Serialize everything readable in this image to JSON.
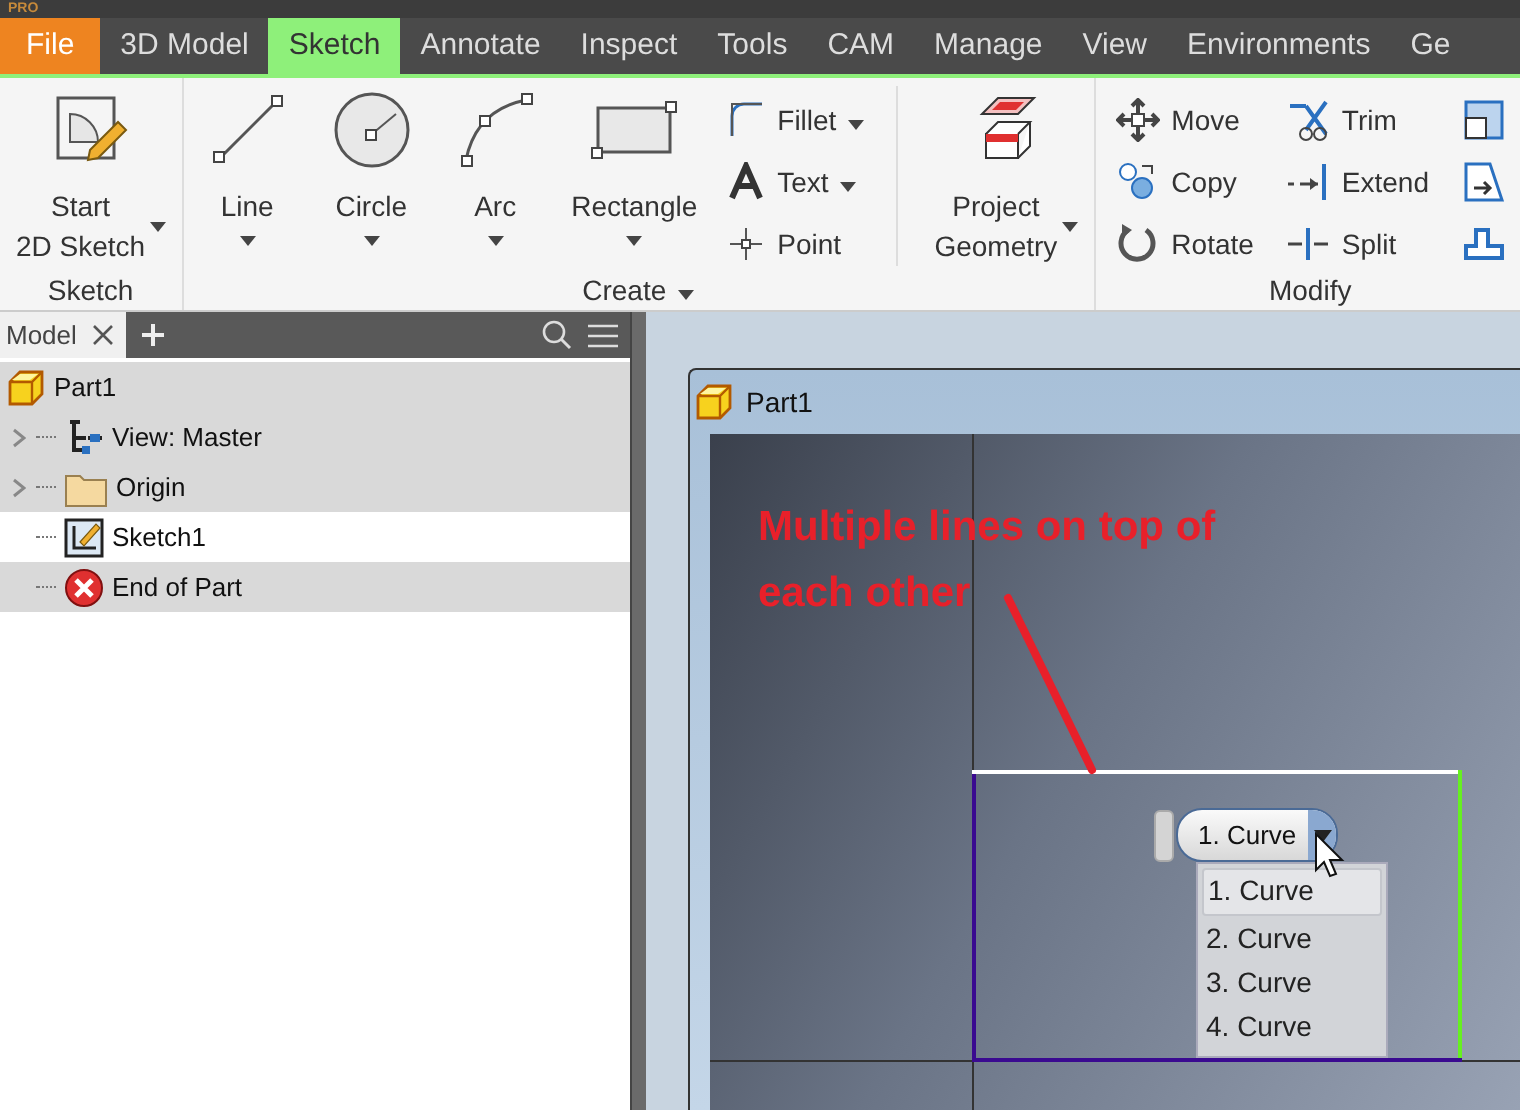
{
  "title_bar": {
    "edition": "PRO"
  },
  "ribbon_tabs": [
    {
      "label": "File",
      "kind": "application",
      "selected": false
    },
    {
      "label": "3D Model",
      "kind": "tab",
      "selected": false
    },
    {
      "label": "Sketch",
      "kind": "tab",
      "selected": true
    },
    {
      "label": "Annotate",
      "kind": "tab",
      "selected": false
    },
    {
      "label": "Inspect",
      "kind": "tab",
      "selected": false
    },
    {
      "label": "Tools",
      "kind": "tab",
      "selected": false
    },
    {
      "label": "CAM",
      "kind": "tab",
      "selected": false
    },
    {
      "label": "Manage",
      "kind": "tab",
      "selected": false
    },
    {
      "label": "View",
      "kind": "tab",
      "selected": false
    },
    {
      "label": "Environments",
      "kind": "tab",
      "selected": false
    },
    {
      "label": "Ge",
      "kind": "tab",
      "selected": false
    }
  ],
  "ribbon_panels": [
    {
      "title": "Sketch",
      "has_menu": false,
      "groups": [
        {
          "kind": "large",
          "tools": [
            {
              "label": "Start\n2D Sketch",
              "has_menu": true
            }
          ]
        }
      ]
    },
    {
      "title": "Create",
      "has_menu": true,
      "groups": [
        {
          "kind": "large",
          "tools": [
            {
              "label": "Line",
              "has_menu": true
            },
            {
              "label": "Circle",
              "has_menu": true
            },
            {
              "label": "Arc",
              "has_menu": true
            },
            {
              "label": "Rectangle",
              "has_menu": true
            }
          ]
        },
        {
          "kind": "small",
          "tools": [
            {
              "label": "Fillet",
              "has_menu": true
            },
            {
              "label": "Text",
              "has_menu": true
            },
            {
              "label": "Point",
              "has_menu": false
            }
          ]
        },
        {
          "kind": "large",
          "tools": [
            {
              "label": "Project\nGeometry",
              "has_menu": true
            }
          ]
        }
      ]
    },
    {
      "title": "Modify",
      "has_menu": false,
      "groups": [
        {
          "kind": "small",
          "tools": [
            {
              "label": "Move",
              "has_menu": false
            },
            {
              "label": "Copy",
              "has_menu": false
            },
            {
              "label": "Rotate",
              "has_menu": false
            }
          ]
        },
        {
          "kind": "small",
          "tools": [
            {
              "label": "Trim",
              "has_menu": false
            },
            {
              "label": "Extend",
              "has_menu": false
            },
            {
              "label": "Split",
              "has_menu": false
            }
          ]
        },
        {
          "kind": "small",
          "tools": [
            {
              "has_menu": false
            },
            {
              "has_menu": false
            },
            {
              "has_menu": false
            }
          ]
        }
      ]
    }
  ],
  "model_browser": {
    "tab": "Model",
    "items": [
      {
        "label": "Part1",
        "kind": "part",
        "active": false,
        "children": [
          {
            "label": "View: Master",
            "kind": "view",
            "active": false,
            "expandable": true
          },
          {
            "label": "Origin",
            "kind": "folder",
            "active": false,
            "expandable": true
          },
          {
            "label": "Sketch1",
            "kind": "sketch",
            "active": true,
            "expandable": false
          },
          {
            "label": "End of Part",
            "kind": "end",
            "active": false,
            "expandable": false
          }
        ]
      }
    ]
  },
  "document_window": {
    "title": "Part1",
    "annotation": "Multiple lines on top of each other",
    "selection_picker": {
      "current": "1. Curve",
      "options": [
        {
          "label": "1. Curve",
          "selected": true
        },
        {
          "label": "2. Curve",
          "selected": false
        },
        {
          "label": "3. Curve",
          "selected": false
        },
        {
          "label": "4. Curve",
          "selected": false
        }
      ]
    }
  }
}
